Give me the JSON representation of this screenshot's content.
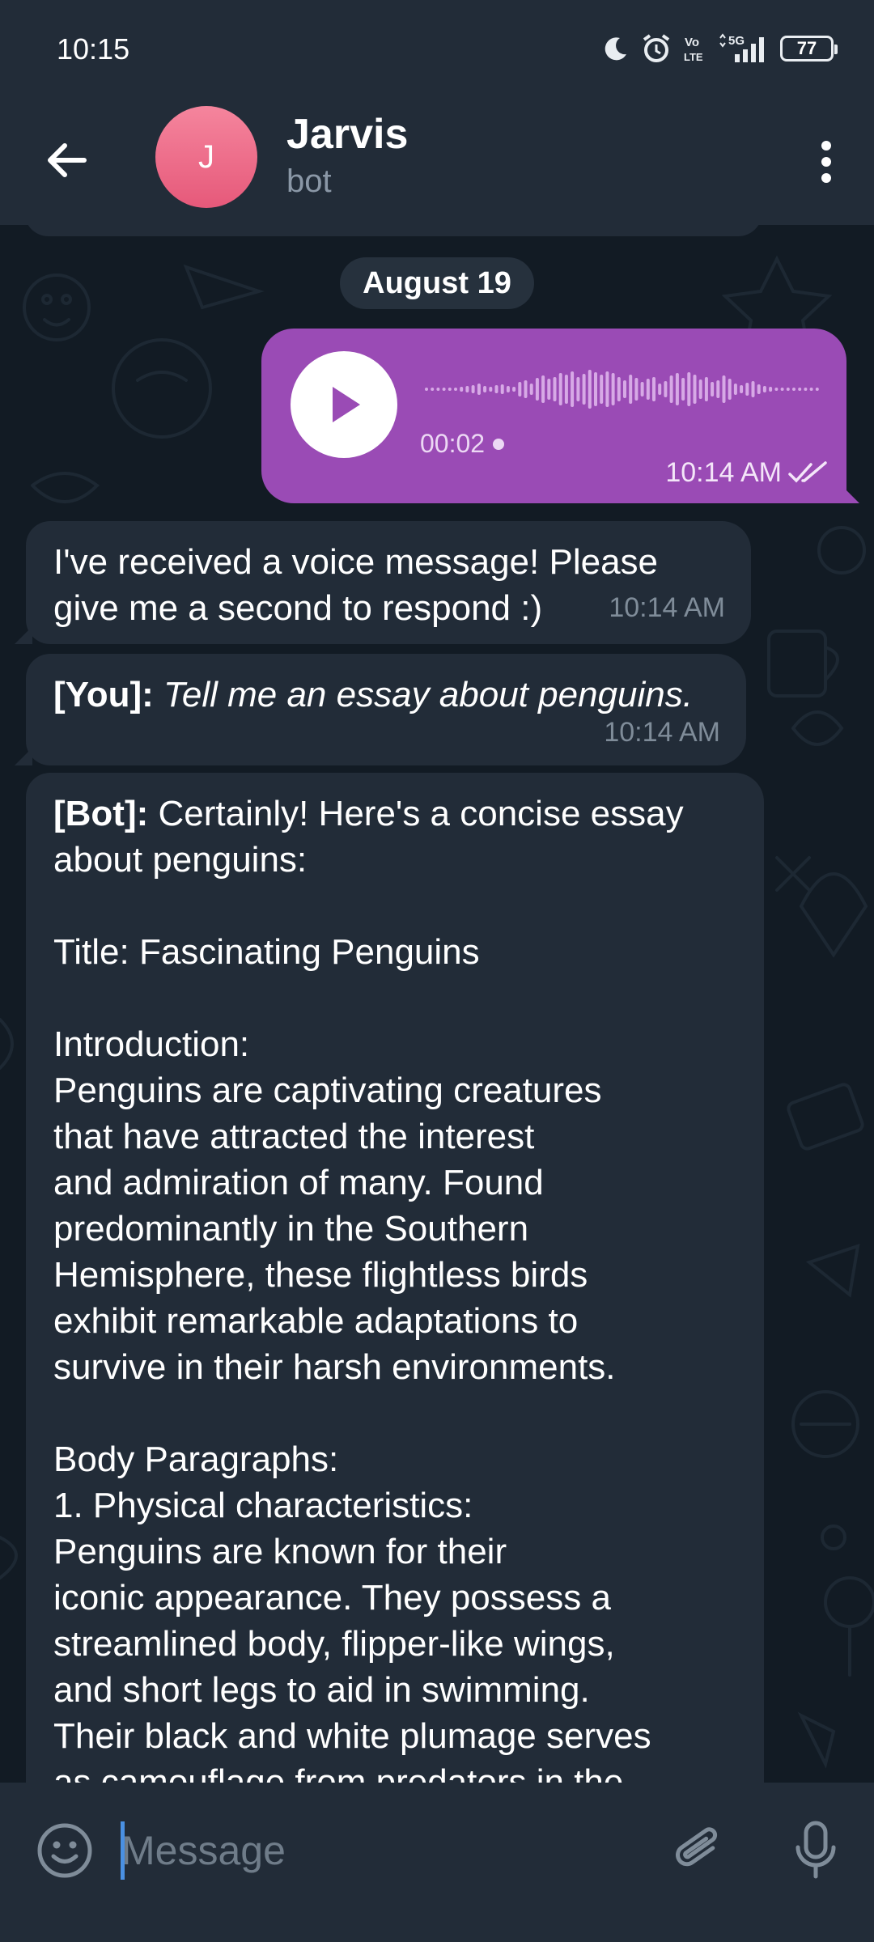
{
  "status_bar": {
    "time": "10:15",
    "battery": "77",
    "icons": [
      "moon-icon",
      "alarm-icon",
      "volte-icon",
      "signal-5g-icon",
      "battery-icon"
    ]
  },
  "header": {
    "avatar_letter": "J",
    "title": "Jarvis",
    "subtitle": "bot"
  },
  "date_separator": "August 19",
  "messages": [
    {
      "type": "voice",
      "direction": "outgoing",
      "duration": "00:02",
      "time": "10:14 AM",
      "status": "read"
    },
    {
      "type": "text",
      "direction": "incoming",
      "line1": "I've received a voice message! Please",
      "line2": "give me a second to respond :)",
      "time": "10:14 AM"
    },
    {
      "type": "text",
      "direction": "incoming",
      "prefix": "[You]:",
      "text": "Tell me an essay about penguins.",
      "time": "10:14 AM"
    },
    {
      "type": "text",
      "direction": "incoming",
      "prefix": "[Bot]:",
      "lines": [
        " Certainly! Here's a concise essay",
        "about penguins:",
        "",
        "Title: Fascinating Penguins",
        "",
        "Introduction:",
        "Penguins are captivating creatures",
        "that have attracted the interest",
        "and admiration of many. Found",
        "predominantly in the Southern",
        "Hemisphere, these flightless birds",
        "exhibit remarkable adaptations to",
        "survive in their harsh environments.",
        "",
        "Body Paragraphs:",
        "1. Physical characteristics:",
        "Penguins are known for their",
        "iconic appearance. They possess a",
        "streamlined body, flipper-like wings,",
        "and short legs to aid in swimming.",
        "Their black and white plumage serves",
        "as camouflage from predators in the"
      ]
    }
  ],
  "composer": {
    "placeholder": "Message"
  },
  "colors": {
    "header_bg": "#222c38",
    "outgoing_bubble": "#9a4bb5",
    "incoming_bubble": "#222c38",
    "avatar": "#e6597a",
    "wallpaper": "#121b24"
  }
}
